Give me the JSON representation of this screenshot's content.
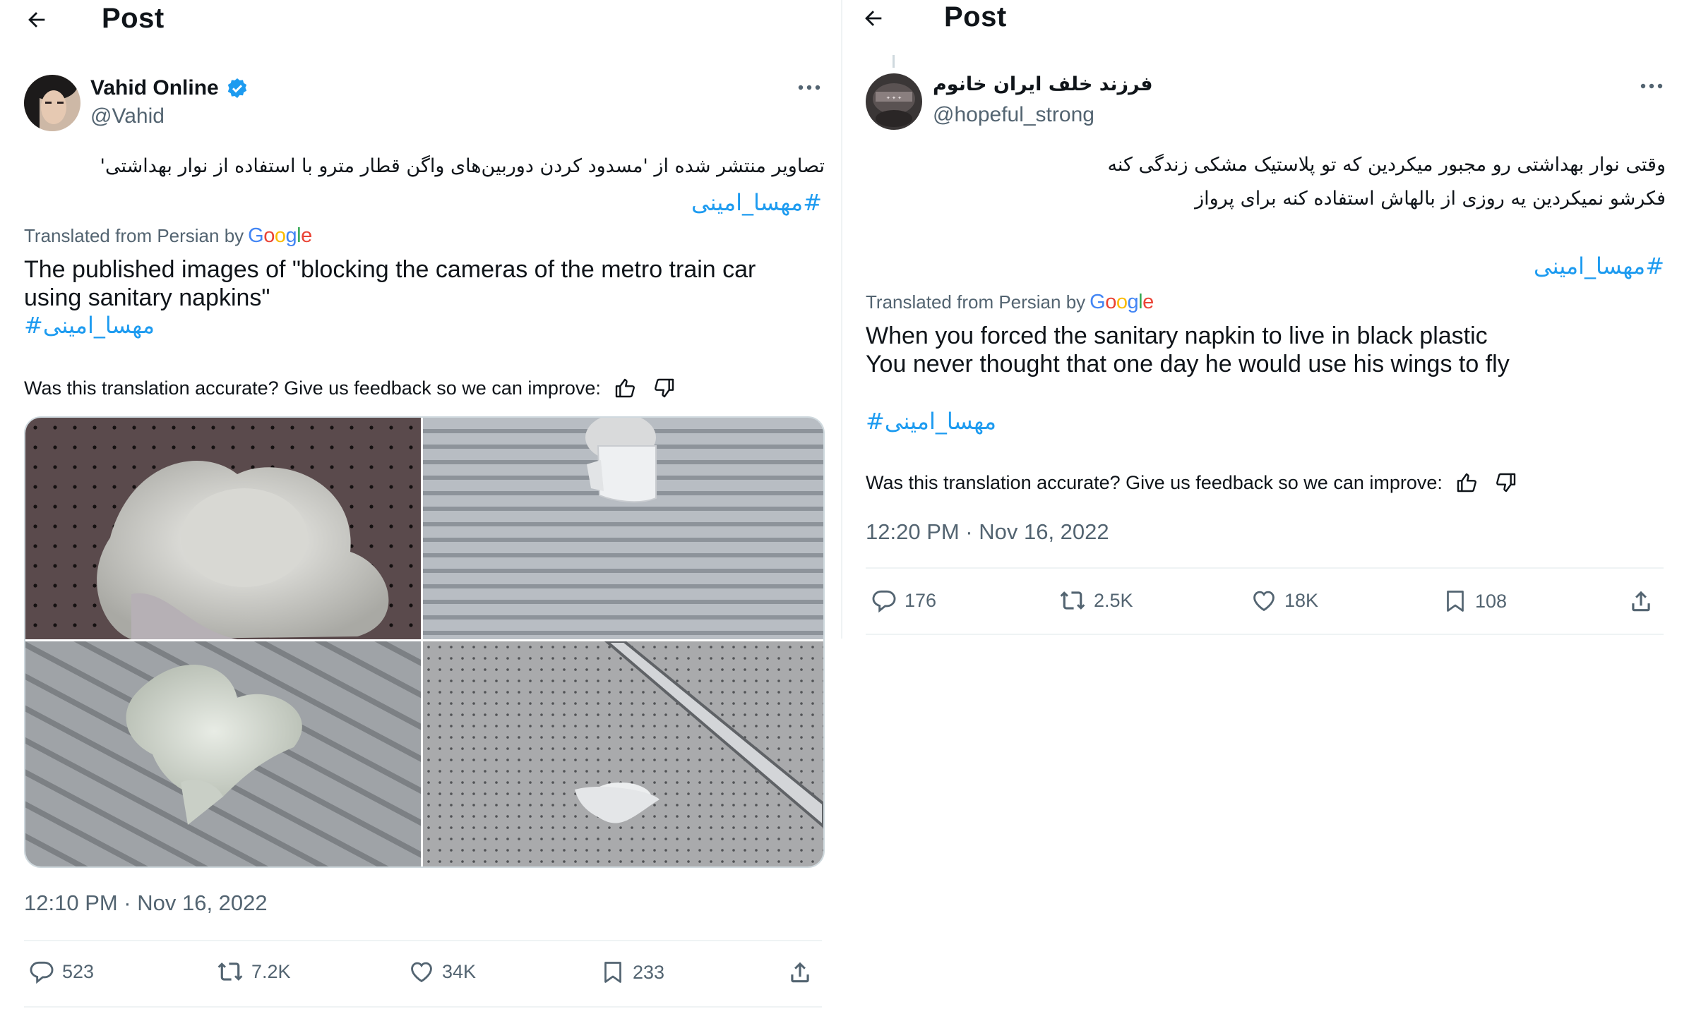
{
  "left_post": {
    "header": {
      "title": "Post"
    },
    "author": {
      "name": "Vahid Online",
      "handle": "@Vahid",
      "verified": true
    },
    "text_fa": "تصاویر منتشر شده از 'مسدود کردن دوربین‌های واگن قطار مترو با استفاده از نوار بهداشتی'",
    "hashtag_fa": "#مهسا_امینی",
    "translated_label": "Translated from Persian by",
    "google_letters": [
      "G",
      "o",
      "o",
      "g",
      "l",
      "e"
    ],
    "text_en": "The published images of \"blocking the cameras of the metro train car using sanitary napkins\"",
    "hashtag_en": "#مهسا_امینی",
    "feedback": "Was this translation accurate? Give us feedback so we can improve:",
    "timestamp": "12:10 PM · Nov 16, 2022",
    "stats": {
      "replies": "523",
      "reposts": "7.2K",
      "likes": "34K",
      "bookmarks": "233"
    }
  },
  "right_post": {
    "header": {
      "title": "Post"
    },
    "author": {
      "name": "فرزند خلف ایران خانوم",
      "handle": "@hopeful_strong",
      "verified": false
    },
    "text_fa_line1": "وقتی نوار بهداشتی رو مجبور میکردین که تو پلاستیک مشکی زندگی کنه",
    "text_fa_line2": "فکرشو نمیکردین یه روزی از بالهاش استفاده کنه برای پرواز",
    "hashtag_fa": "#مهسا_امینی",
    "translated_label": "Translated from Persian by",
    "google_letters": [
      "G",
      "o",
      "o",
      "g",
      "l",
      "e"
    ],
    "text_en_line1": "When you forced the sanitary napkin to live in black plastic",
    "text_en_line2": "You never thought that one day he would use his wings to fly",
    "hashtag_en": "#مهسا_امینی",
    "feedback": "Was this translation accurate? Give us feedback so we can improve:",
    "timestamp": "12:20 PM · Nov 16, 2022",
    "stats": {
      "replies": "176",
      "reposts": "2.5K",
      "likes": "18K",
      "bookmarks": "108"
    }
  },
  "colors": {
    "accent": "#1d9bf0",
    "muted": "#536471",
    "text": "#0f1419",
    "border": "#eff3f4"
  },
  "icons": [
    "back-arrow-icon",
    "verified-badge-icon",
    "more-icon",
    "thumbs-up-icon",
    "thumbs-down-icon",
    "reply-icon",
    "repost-icon",
    "like-icon",
    "bookmark-icon",
    "share-icon"
  ]
}
